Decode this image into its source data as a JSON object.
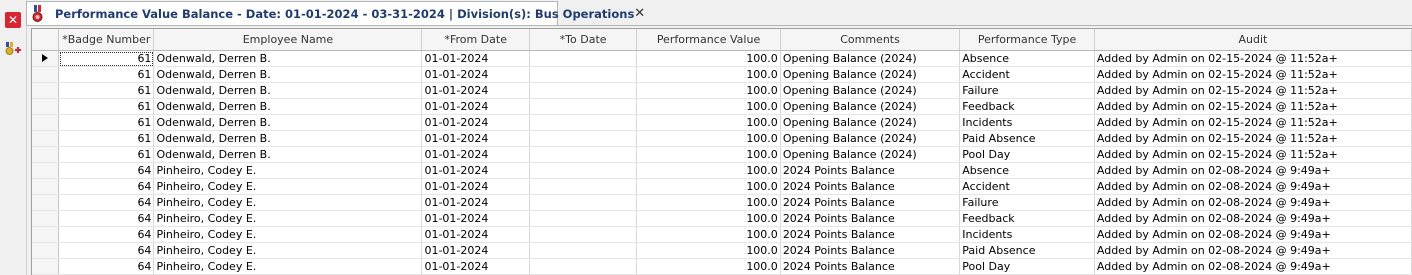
{
  "left_rail": {
    "close_icon": "close-icon",
    "add_award_icon": "award-add-icon"
  },
  "tab": {
    "icon": "award-ribbon-icon",
    "title": "Performance Value Balance - Date: 01-01-2024 - 03-31-2024 | Division(s): Bus Operations",
    "close_label": "✕"
  },
  "grid": {
    "columns": [
      "*Badge Number",
      "Employee Name",
      "*From Date",
      "*To Date",
      "Performance Value",
      "Comments",
      "Performance Type",
      "Audit"
    ],
    "rows": [
      {
        "badge": "61",
        "name": "Odenwald, Derren B.",
        "from": "01-01-2024",
        "to": "",
        "value": "100.0",
        "comments": "Opening Balance (2024)",
        "type": "Absence",
        "audit": "Added by Admin on 02-15-2024 @ 11:52a+"
      },
      {
        "badge": "61",
        "name": "Odenwald, Derren B.",
        "from": "01-01-2024",
        "to": "",
        "value": "100.0",
        "comments": "Opening Balance (2024)",
        "type": "Accident",
        "audit": "Added by Admin on 02-15-2024 @ 11:52a+"
      },
      {
        "badge": "61",
        "name": "Odenwald, Derren B.",
        "from": "01-01-2024",
        "to": "",
        "value": "100.0",
        "comments": "Opening Balance (2024)",
        "type": "Failure",
        "audit": "Added by Admin on 02-15-2024 @ 11:52a+"
      },
      {
        "badge": "61",
        "name": "Odenwald, Derren B.",
        "from": "01-01-2024",
        "to": "",
        "value": "100.0",
        "comments": "Opening Balance (2024)",
        "type": "Feedback",
        "audit": "Added by Admin on 02-15-2024 @ 11:52a+"
      },
      {
        "badge": "61",
        "name": "Odenwald, Derren B.",
        "from": "01-01-2024",
        "to": "",
        "value": "100.0",
        "comments": "Opening Balance (2024)",
        "type": "Incidents",
        "audit": "Added by Admin on 02-15-2024 @ 11:52a+"
      },
      {
        "badge": "61",
        "name": "Odenwald, Derren B.",
        "from": "01-01-2024",
        "to": "",
        "value": "100.0",
        "comments": "Opening Balance (2024)",
        "type": "Paid Absence",
        "audit": "Added by Admin on 02-15-2024 @ 11:52a+"
      },
      {
        "badge": "61",
        "name": "Odenwald, Derren B.",
        "from": "01-01-2024",
        "to": "",
        "value": "100.0",
        "comments": "Opening Balance (2024)",
        "type": "Pool Day",
        "audit": "Added by Admin on 02-15-2024 @ 11:52a+"
      },
      {
        "badge": "64",
        "name": "Pinheiro, Codey E.",
        "from": "01-01-2024",
        "to": "",
        "value": "100.0",
        "comments": "2024 Points Balance",
        "type": "Absence",
        "audit": "Added by Admin on 02-08-2024 @  9:49a+"
      },
      {
        "badge": "64",
        "name": "Pinheiro, Codey E.",
        "from": "01-01-2024",
        "to": "",
        "value": "100.0",
        "comments": "2024 Points Balance",
        "type": "Accident",
        "audit": "Added by Admin on 02-08-2024 @  9:49a+"
      },
      {
        "badge": "64",
        "name": "Pinheiro, Codey E.",
        "from": "01-01-2024",
        "to": "",
        "value": "100.0",
        "comments": "2024 Points Balance",
        "type": "Failure",
        "audit": "Added by Admin on 02-08-2024 @  9:49a+"
      },
      {
        "badge": "64",
        "name": "Pinheiro, Codey E.",
        "from": "01-01-2024",
        "to": "",
        "value": "100.0",
        "comments": "2024 Points Balance",
        "type": "Feedback",
        "audit": "Added by Admin on 02-08-2024 @  9:49a+"
      },
      {
        "badge": "64",
        "name": "Pinheiro, Codey E.",
        "from": "01-01-2024",
        "to": "",
        "value": "100.0",
        "comments": "2024 Points Balance",
        "type": "Incidents",
        "audit": "Added by Admin on 02-08-2024 @  9:49a+"
      },
      {
        "badge": "64",
        "name": "Pinheiro, Codey E.",
        "from": "01-01-2024",
        "to": "",
        "value": "100.0",
        "comments": "2024 Points Balance",
        "type": "Paid Absence",
        "audit": "Added by Admin on 02-08-2024 @  9:49a+"
      },
      {
        "badge": "64",
        "name": "Pinheiro, Codey E.",
        "from": "01-01-2024",
        "to": "",
        "value": "100.0",
        "comments": "2024 Points Balance",
        "type": "Pool Day",
        "audit": "Added by Admin on 02-08-2024 @  9:49a+"
      }
    ]
  },
  "colors": {
    "title_text": "#1f3b73",
    "close_button": "#d9252f"
  }
}
